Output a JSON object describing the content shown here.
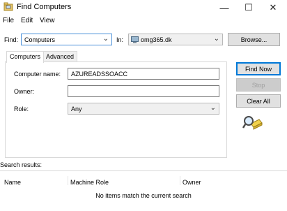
{
  "window": {
    "title": "Find Computers",
    "minimize": "—",
    "maximize": "☐",
    "close": "✕"
  },
  "menu": [
    "File",
    "Edit",
    "View"
  ],
  "find": {
    "label": "Find:",
    "value": "Computers",
    "in_label": "In:",
    "in_value": "omg365.dk",
    "browse_label": "Browse..."
  },
  "tabs": [
    "Computers",
    "Advanced"
  ],
  "form": {
    "computer_name_label": "Computer name:",
    "computer_name_value": "AZUREADSSOACC",
    "owner_label": "Owner:",
    "owner_value": "",
    "role_label": "Role:",
    "role_value": "Any"
  },
  "actions": {
    "find_now": "Find Now",
    "stop": "Stop",
    "clear_all": "Clear All"
  },
  "results": {
    "label": "Search results:",
    "columns": [
      "Name",
      "Machine Role",
      "Owner"
    ],
    "empty_message": "No items match the current search"
  }
}
